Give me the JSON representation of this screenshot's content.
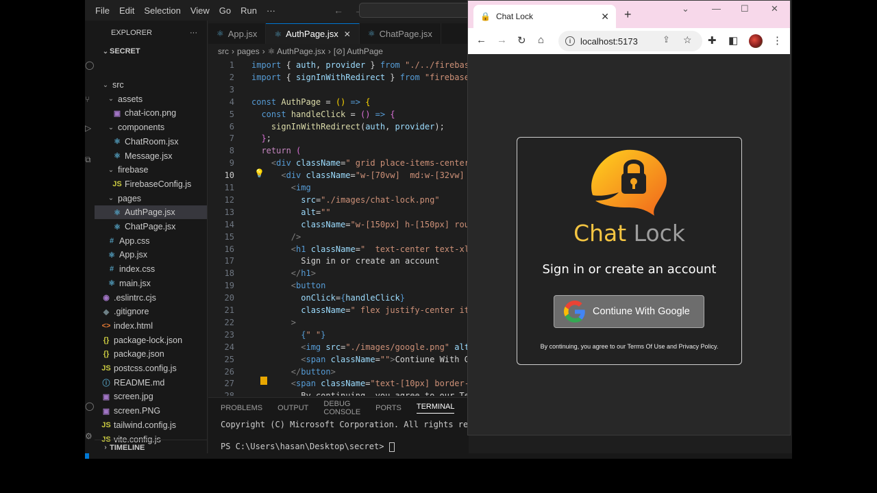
{
  "vscode": {
    "menu": [
      "File",
      "Edit",
      "Selection",
      "View",
      "Go",
      "Run",
      "···"
    ],
    "explorer_title": "EXPLORER",
    "explorer_more": "···",
    "project": "SECRET",
    "timeline": "TIMELINE",
    "tree": [
      {
        "name": "src",
        "icon": "",
        "twisty": "⌄",
        "indent": 1
      },
      {
        "name": "assets",
        "icon": "",
        "twisty": "⌄",
        "indent": 2
      },
      {
        "name": "chat-icon.png",
        "icon": "▣",
        "twisty": "",
        "indent": 3
      },
      {
        "name": "components",
        "icon": "",
        "twisty": "⌄",
        "indent": 2
      },
      {
        "name": "ChatRoom.jsx",
        "icon": "⚛",
        "twisty": "",
        "indent": 3
      },
      {
        "name": "Message.jsx",
        "icon": "⚛",
        "twisty": "",
        "indent": 3
      },
      {
        "name": "firebase",
        "icon": "",
        "twisty": "⌄",
        "indent": 2
      },
      {
        "name": "FirebaseConfig.js",
        "icon": "JS",
        "twisty": "",
        "indent": 3
      },
      {
        "name": "pages",
        "icon": "",
        "twisty": "⌄",
        "indent": 2
      },
      {
        "name": "AuthPage.jsx",
        "icon": "⚛",
        "twisty": "",
        "indent": 3,
        "selected": true
      },
      {
        "name": "ChatPage.jsx",
        "icon": "⚛",
        "twisty": "",
        "indent": 3
      },
      {
        "name": "App.css",
        "icon": "#",
        "twisty": "",
        "indent": 2
      },
      {
        "name": "App.jsx",
        "icon": "⚛",
        "twisty": "",
        "indent": 2
      },
      {
        "name": "index.css",
        "icon": "#",
        "twisty": "",
        "indent": 2
      },
      {
        "name": "main.jsx",
        "icon": "⚛",
        "twisty": "",
        "indent": 2
      },
      {
        "name": ".eslintrc.cjs",
        "icon": "◉",
        "twisty": "",
        "indent": 1
      },
      {
        "name": ".gitignore",
        "icon": "◆",
        "twisty": "",
        "indent": 1
      },
      {
        "name": "index.html",
        "icon": "<>",
        "twisty": "",
        "indent": 1
      },
      {
        "name": "package-lock.json",
        "icon": "{}",
        "twisty": "",
        "indent": 1
      },
      {
        "name": "package.json",
        "icon": "{}",
        "twisty": "",
        "indent": 1
      },
      {
        "name": "postcss.config.js",
        "icon": "JS",
        "twisty": "",
        "indent": 1
      },
      {
        "name": "README.md",
        "icon": "ⓘ",
        "twisty": "",
        "indent": 1
      },
      {
        "name": "screen.jpg",
        "icon": "▣",
        "twisty": "",
        "indent": 1
      },
      {
        "name": "screen.PNG",
        "icon": "▣",
        "twisty": "",
        "indent": 1
      },
      {
        "name": "tailwind.config.js",
        "icon": "JS",
        "twisty": "",
        "indent": 1
      },
      {
        "name": "vite.config.js",
        "icon": "JS",
        "twisty": "",
        "indent": 1
      }
    ],
    "tabs": [
      {
        "label": "App.jsx",
        "active": false
      },
      {
        "label": "AuthPage.jsx",
        "active": true,
        "close": "✕"
      },
      {
        "label": "ChatPage.jsx",
        "active": false
      }
    ],
    "breadcrumbs": [
      "src",
      "›",
      "pages",
      "›",
      "⚛ AuthPage.jsx",
      "›",
      "[⊘] AuthPage"
    ],
    "current_line": 10,
    "code_lines": [
      [
        [
          "kw",
          "import "
        ],
        [
          "pl",
          "{ "
        ],
        [
          "vr",
          "auth"
        ],
        [
          "pl",
          ", "
        ],
        [
          "vr",
          "provider"
        ],
        [
          "pl",
          " } "
        ],
        [
          "kw",
          "from "
        ],
        [
          "st",
          "\"./../firebase"
        ]
      ],
      [
        [
          "kw",
          "import "
        ],
        [
          "pl",
          "{ "
        ],
        [
          "vr",
          "signInWithRedirect"
        ],
        [
          "pl",
          " } "
        ],
        [
          "kw",
          "from "
        ],
        [
          "st",
          "\"firebase"
        ]
      ],
      [],
      [
        [
          "kw",
          "const "
        ],
        [
          "fn",
          "AuthPage"
        ],
        [
          "pl",
          " = "
        ],
        [
          "br",
          "()"
        ],
        [
          "pl",
          " "
        ],
        [
          "kw",
          "=>"
        ],
        [
          "pl",
          " "
        ],
        [
          "br",
          "{"
        ]
      ],
      [
        [
          "pl",
          "  "
        ],
        [
          "kw",
          "const "
        ],
        [
          "fn",
          "handleClick"
        ],
        [
          "pl",
          " = "
        ],
        [
          "br2",
          "()"
        ],
        [
          "pl",
          " "
        ],
        [
          "kw",
          "=>"
        ],
        [
          "pl",
          " "
        ],
        [
          "br2",
          "{"
        ]
      ],
      [
        [
          "pl",
          "    "
        ],
        [
          "fn",
          "signInWithRedirect"
        ],
        [
          "pl",
          "("
        ],
        [
          "vr",
          "auth"
        ],
        [
          "pl",
          ", "
        ],
        [
          "vr",
          "provider"
        ],
        [
          "pl",
          ");"
        ]
      ],
      [
        [
          "pl",
          "  "
        ],
        [
          "br2",
          "}"
        ],
        [
          "pl",
          ";"
        ]
      ],
      [
        [
          "pl",
          "  "
        ],
        [
          "ky",
          "return "
        ],
        [
          "br2",
          "("
        ]
      ],
      [
        [
          "pl",
          "    "
        ],
        [
          "tg",
          "<"
        ],
        [
          "tn",
          "div "
        ],
        [
          "at",
          "className"
        ],
        [
          "pl",
          "="
        ],
        [
          "st",
          "\" grid place-items-center"
        ]
      ],
      [
        [
          "pl",
          "      "
        ],
        [
          "tg",
          "<"
        ],
        [
          "tn",
          "div "
        ],
        [
          "at",
          "className"
        ],
        [
          "pl",
          "="
        ],
        [
          "st",
          "\"w-[70vw]  md:w-[32vw]"
        ]
      ],
      [
        [
          "pl",
          "        "
        ],
        [
          "tg",
          "<"
        ],
        [
          "tn",
          "img"
        ]
      ],
      [
        [
          "pl",
          "          "
        ],
        [
          "at",
          "src"
        ],
        [
          "pl",
          "="
        ],
        [
          "st",
          "\"./images/chat-lock.png\""
        ]
      ],
      [
        [
          "pl",
          "          "
        ],
        [
          "at",
          "alt"
        ],
        [
          "pl",
          "="
        ],
        [
          "st",
          "\"\""
        ]
      ],
      [
        [
          "pl",
          "          "
        ],
        [
          "at",
          "className"
        ],
        [
          "pl",
          "="
        ],
        [
          "st",
          "\"w-[150px] h-[150px] rou"
        ]
      ],
      [
        [
          "pl",
          "        "
        ],
        [
          "tg",
          "/>"
        ]
      ],
      [
        [
          "pl",
          "        "
        ],
        [
          "tg",
          "<"
        ],
        [
          "tn",
          "h1 "
        ],
        [
          "at",
          "className"
        ],
        [
          "pl",
          "="
        ],
        [
          "st",
          "\"  text-center text-xl"
        ]
      ],
      [
        [
          "pl",
          "          Sign in or create an account"
        ]
      ],
      [
        [
          "pl",
          "        "
        ],
        [
          "tg",
          "</"
        ],
        [
          "tn",
          "h1"
        ],
        [
          "tg",
          ">"
        ]
      ],
      [
        [
          "pl",
          "        "
        ],
        [
          "tg",
          "<"
        ],
        [
          "tn",
          "button"
        ]
      ],
      [
        [
          "pl",
          "          "
        ],
        [
          "at",
          "onClick"
        ],
        [
          "pl",
          "="
        ],
        [
          "kw",
          "{"
        ],
        [
          "vr",
          "handleClick"
        ],
        [
          "kw",
          "}"
        ]
      ],
      [
        [
          "pl",
          "          "
        ],
        [
          "at",
          "className"
        ],
        [
          "pl",
          "="
        ],
        [
          "st",
          "\" flex justify-center it"
        ]
      ],
      [
        [
          "pl",
          "        "
        ],
        [
          "tg",
          ">"
        ]
      ],
      [
        [
          "pl",
          "          "
        ],
        [
          "kw",
          "{"
        ],
        [
          "st",
          "\" \""
        ],
        [
          "kw",
          "}"
        ]
      ],
      [
        [
          "pl",
          "          "
        ],
        [
          "tg",
          "<"
        ],
        [
          "tn",
          "img "
        ],
        [
          "at",
          "src"
        ],
        [
          "pl",
          "="
        ],
        [
          "st",
          "\"./images/google.png\""
        ],
        [
          "pl",
          " "
        ],
        [
          "at",
          "alt"
        ]
      ],
      [
        [
          "pl",
          "          "
        ],
        [
          "tg",
          "<"
        ],
        [
          "tn",
          "span "
        ],
        [
          "at",
          "className"
        ],
        [
          "pl",
          "="
        ],
        [
          "st",
          "\"\""
        ],
        [
          "tg",
          ">"
        ],
        [
          "pl",
          "Contiune With G"
        ]
      ],
      [
        [
          "pl",
          "        "
        ],
        [
          "tg",
          "</"
        ],
        [
          "tn",
          "button"
        ],
        [
          "tg",
          ">"
        ]
      ],
      [
        [
          "pl",
          "        "
        ],
        [
          "tg",
          "<"
        ],
        [
          "tn",
          "span "
        ],
        [
          "at",
          "className"
        ],
        [
          "pl",
          "="
        ],
        [
          "st",
          "\"text-[10px] border-"
        ]
      ],
      [
        [
          "pl",
          "          By continuing, you agree to our Te"
        ]
      ]
    ],
    "panel_tabs": [
      {
        "label": "PROBLEMS",
        "active": false
      },
      {
        "label": "OUTPUT",
        "active": false
      },
      {
        "label": "DEBUG CONSOLE",
        "active": false
      },
      {
        "label": "PORTS",
        "active": false
      },
      {
        "label": "TERMINAL",
        "active": true
      }
    ],
    "terminal": {
      "line1": "Copyright (C) Microsoft Corporation. All rights reserved.",
      "prompt": "PS C:\\Users\\hasan\\Desktop\\secret> "
    }
  },
  "chrome": {
    "tab_title": "Chat Lock",
    "tab_close": "✕",
    "new_tab": "+",
    "url": "localhost:5173",
    "window_controls": [
      "⌄",
      "—",
      "☐",
      "✕"
    ]
  },
  "page": {
    "brand_part1": "Chat",
    "brand_part2": " Lock",
    "subtitle": "Sign in or create an account",
    "google_button": "Contiune With Google",
    "terms": "By continuing, you agree to our Terms Of Use and Privacy Policy.",
    "brand_color": "#f4c542"
  }
}
